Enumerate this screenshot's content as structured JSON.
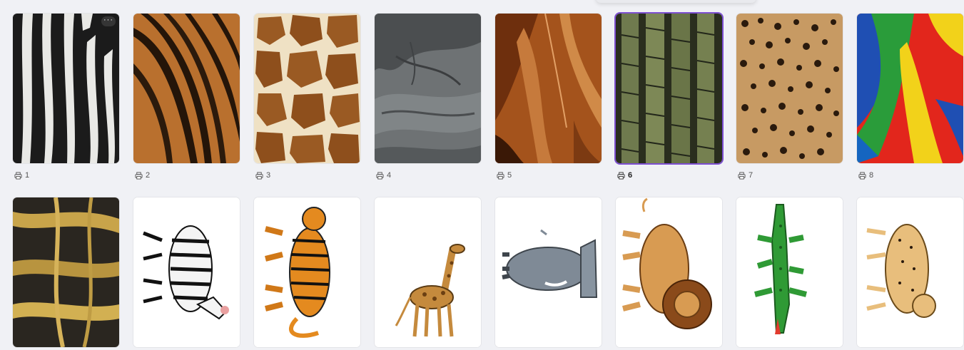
{
  "pages_row1": [
    {
      "label": "1",
      "icon": "print-icon",
      "image": "zebra-fur-texture"
    },
    {
      "label": "2",
      "icon": "print-icon",
      "image": "tiger-fur-texture"
    },
    {
      "label": "3",
      "icon": "print-icon",
      "image": "giraffe-pattern-texture"
    },
    {
      "label": "4",
      "icon": "print-icon",
      "image": "elephant-skin-texture"
    },
    {
      "label": "5",
      "icon": "print-icon",
      "image": "lion-mane-texture"
    },
    {
      "label": "6",
      "icon": "print-icon",
      "image": "crocodile-skin-texture",
      "selected": true
    },
    {
      "label": "7",
      "icon": "print-icon",
      "image": "leopard-spots-texture"
    },
    {
      "label": "8",
      "icon": "print-icon",
      "image": "parrot-feathers-texture"
    }
  ],
  "pages_row2": [
    {
      "image": "tortoise-shell-texture"
    },
    {
      "image": "zebra-illustration"
    },
    {
      "image": "tiger-illustration"
    },
    {
      "image": "giraffe-illustration"
    },
    {
      "image": "elephant-illustration"
    },
    {
      "image": "lion-illustration"
    },
    {
      "image": "crocodile-illustration"
    },
    {
      "image": "cheetah-illustration"
    }
  ],
  "more_button": {
    "label": "···",
    "icon": "more-options-icon"
  },
  "colors": {
    "selected_border": "#7d4fd1",
    "background": "#f0f1f5"
  }
}
